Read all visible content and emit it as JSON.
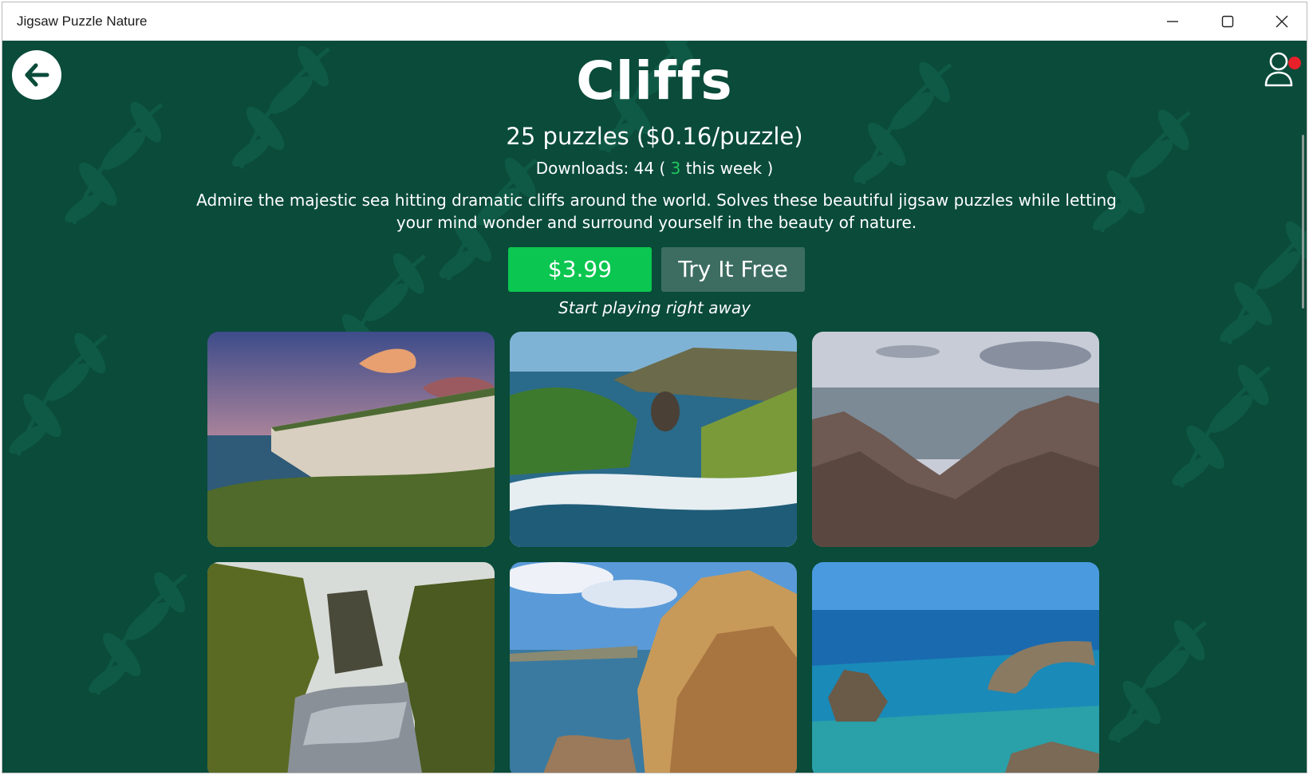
{
  "window": {
    "title": "Jigsaw Puzzle Nature"
  },
  "header": {
    "back_icon": "arrow-left-icon",
    "user_icon": "user-icon",
    "notification_color": "#e8202a"
  },
  "pack": {
    "name": "Cliffs",
    "puzzles_summary": "25 puzzles ($0.16/puzzle)",
    "downloads_prefix": "Downloads: 44 ( ",
    "downloads_weekly": "3",
    "downloads_suffix": " this week )",
    "description": "Admire the majestic sea hitting dramatic cliffs around the world. Solves these beautiful jigsaw puzzles while letting your mind wonder and surround yourself in the beauty of nature.",
    "price_label": "$3.99",
    "try_label": "Try It Free",
    "caption": "Start playing right away"
  },
  "colors": {
    "background": "#0a4b3a",
    "price_button": "#0bc650",
    "try_button": "#3d6d61",
    "weekly_count": "#22c55e"
  },
  "thumbnails": [
    "white-chalk-cliffs-sunset",
    "green-headland-waves",
    "jagged-rocky-coast",
    "mossy-canyon-river",
    "golden-sea-cliffs",
    "turquoise-sea-arch"
  ]
}
